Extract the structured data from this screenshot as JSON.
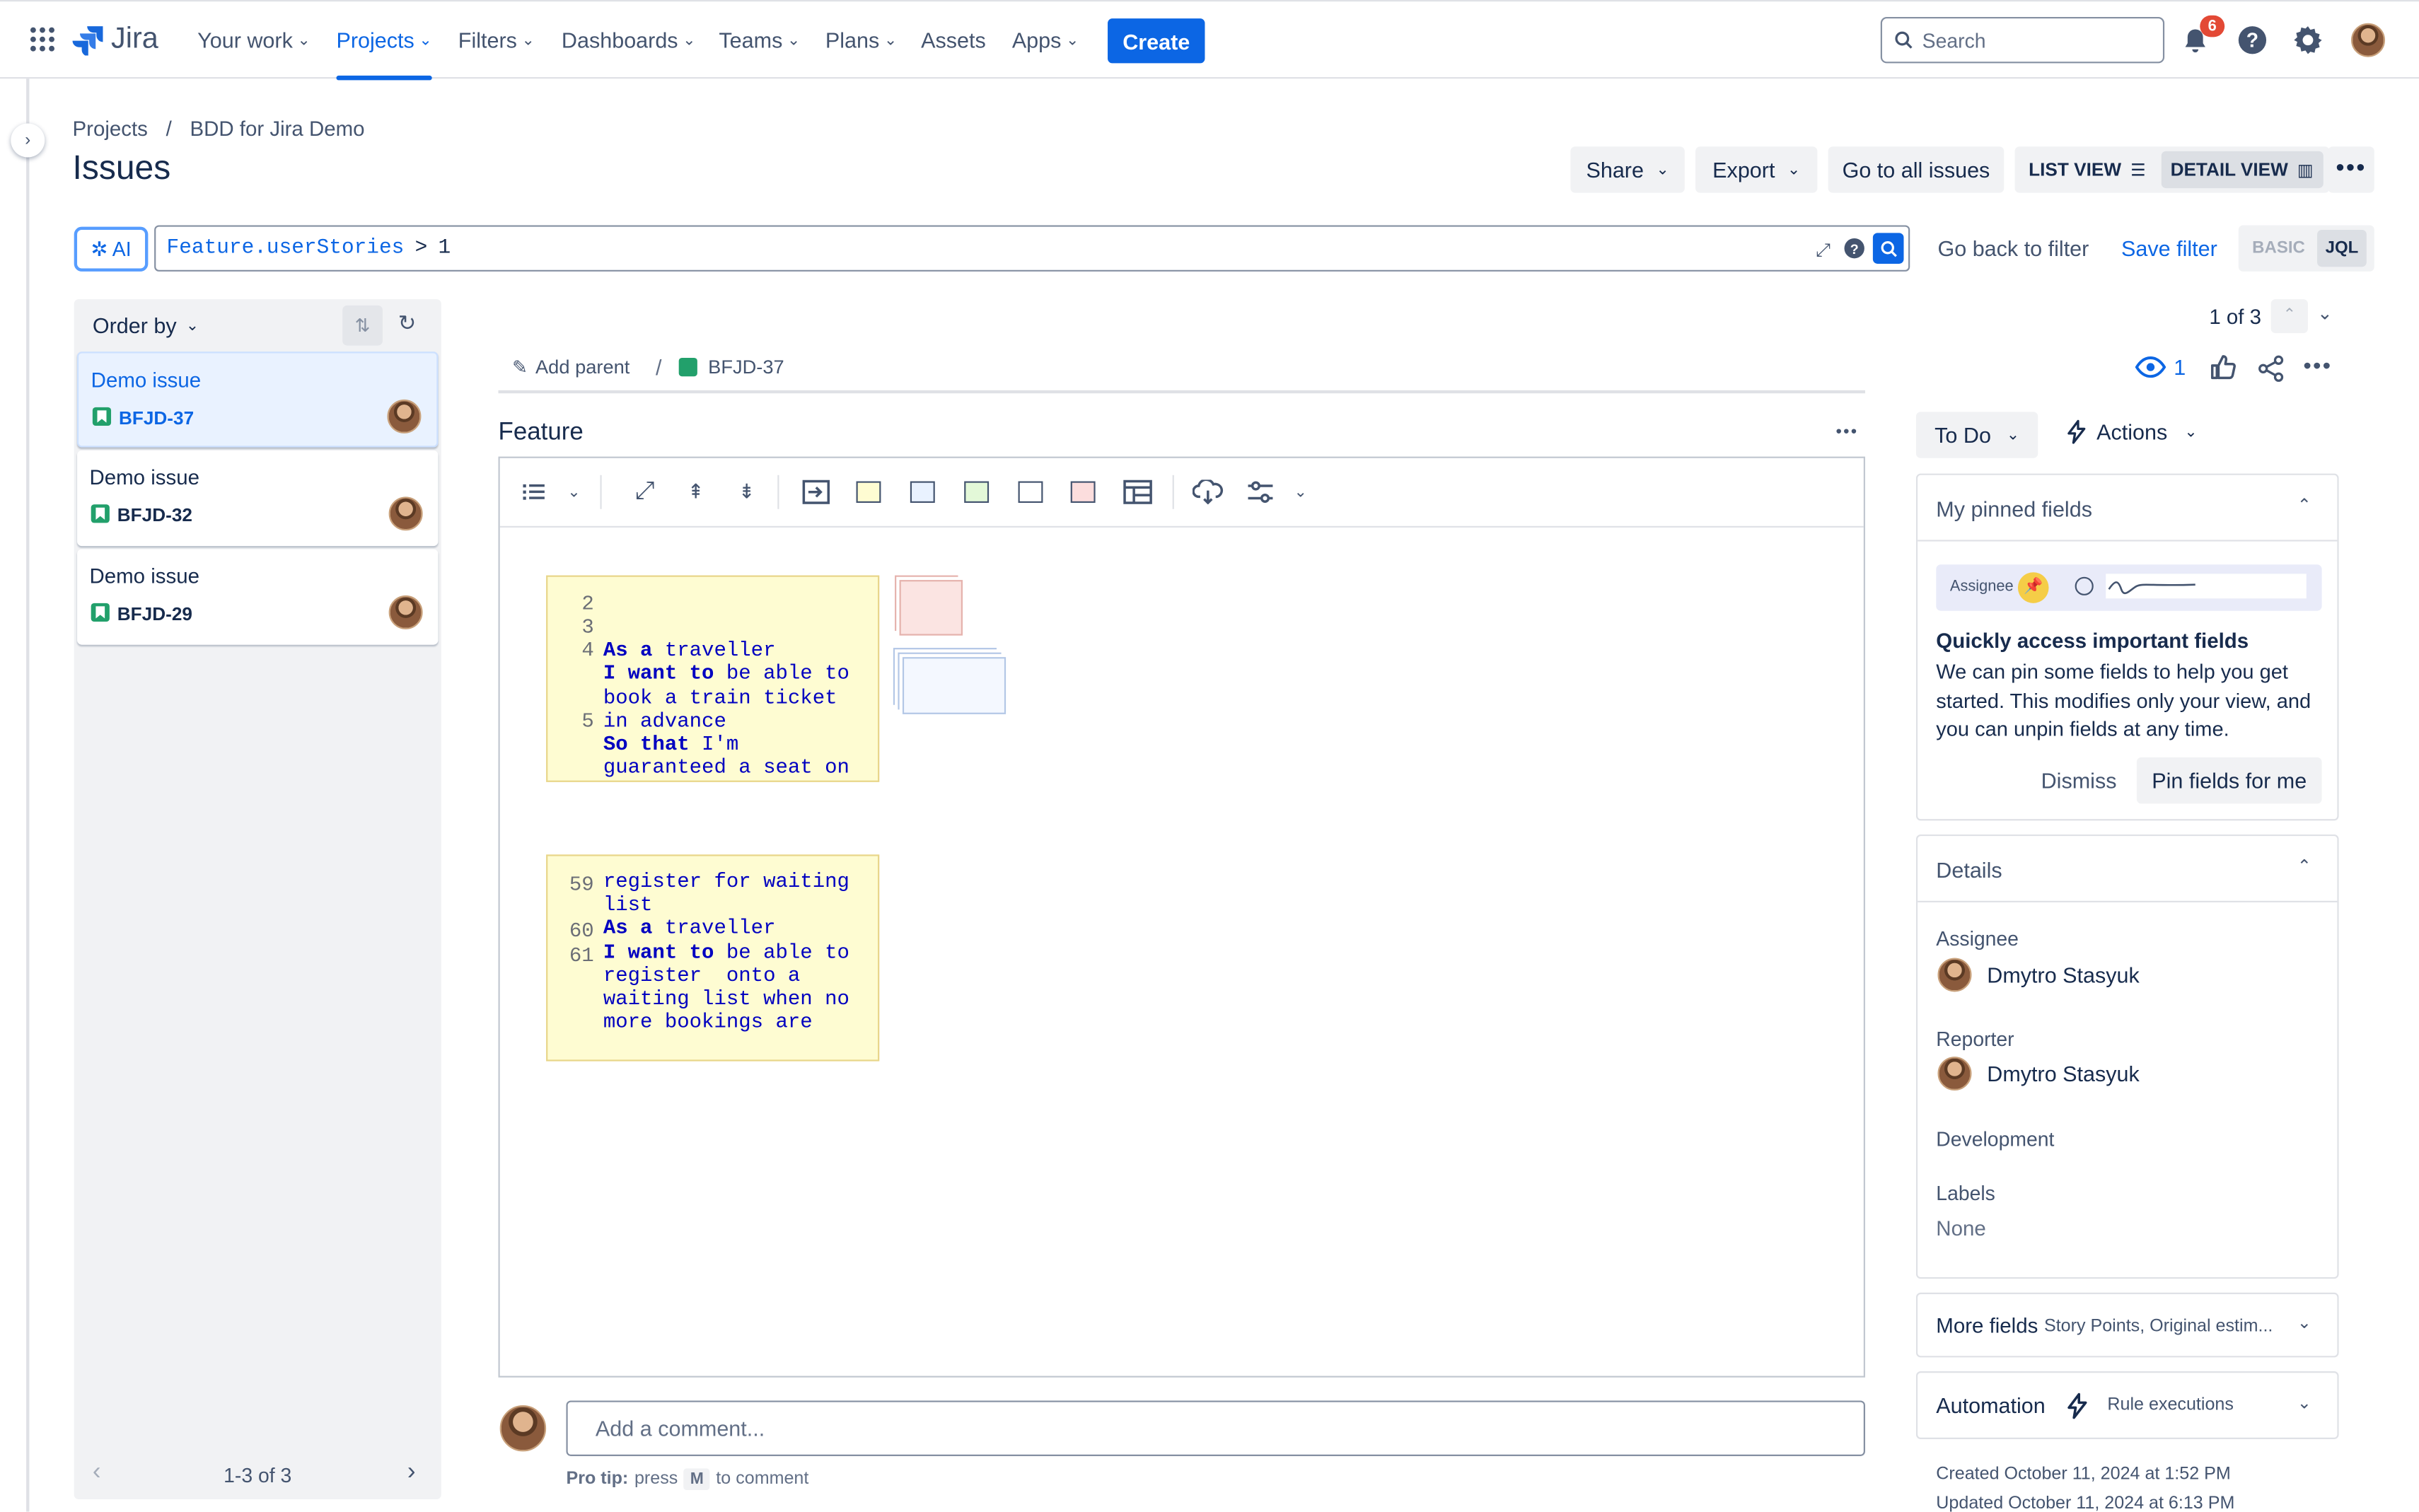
{
  "app": {
    "name": "Jira"
  },
  "nav": {
    "items": [
      {
        "label": "Your work"
      },
      {
        "label": "Projects"
      },
      {
        "label": "Filters"
      },
      {
        "label": "Dashboards"
      },
      {
        "label": "Teams"
      },
      {
        "label": "Plans"
      },
      {
        "label": "Assets"
      },
      {
        "label": "Apps"
      }
    ],
    "create": "Create",
    "search_placeholder": "Search",
    "notif_count": "6"
  },
  "breadcrumb": {
    "projects": "Projects",
    "sep": "/",
    "project": "BDD for Jira Demo"
  },
  "page": {
    "title": "Issues"
  },
  "toolbar": {
    "share": "Share",
    "export": "Export",
    "go_all": "Go to all issues",
    "list_view": "LIST VIEW",
    "detail_view": "DETAIL VIEW"
  },
  "filterbar": {
    "ai": "AI",
    "jql_field": "Feature.userStories",
    "jql_op": ">",
    "jql_value": "1",
    "go_back": "Go back to filter",
    "save": "Save filter",
    "basic": "BASIC",
    "jql": "JQL"
  },
  "list": {
    "order_by": "Order by",
    "pagination": "1-3 of 3",
    "issues": [
      {
        "title": "Demo issue",
        "key": "BFJD-37"
      },
      {
        "title": "Demo issue",
        "key": "BFJD-32"
      },
      {
        "title": "Demo issue",
        "key": "BFJD-29"
      }
    ]
  },
  "issue": {
    "counter": "1 of 3",
    "add_parent": "Add parent",
    "key": "BFJD-37",
    "watchers": "1",
    "field_title": "Feature"
  },
  "editor": {
    "note1": {
      "lines": [
        "2",
        "3",
        "4",
        "",
        "",
        "5",
        ""
      ],
      "text": [
        {
          "kw": "",
          "t": ""
        },
        {
          "kw": "As a",
          "t": " traveller"
        },
        {
          "kw": "I want to",
          "t": " be able to book a train ticket in advance"
        },
        {
          "kw": "So that",
          "t": " I'm guaranteed a seat on my travel"
        }
      ]
    },
    "note2": {
      "text": [
        {
          "kw": "",
          "t": "register for waiting list"
        },
        {
          "kw": "As a",
          "t": " traveller"
        },
        {
          "kw": "I want to",
          "t": " be able to register  onto a waiting list when no more bookings are"
        }
      ]
    }
  },
  "comment": {
    "placeholder": "Add a comment...",
    "pro_tip": "Pro tip:",
    "press": "press",
    "key": "M",
    "to_comment": "to comment"
  },
  "sidebar": {
    "status": "To Do",
    "actions": "Actions",
    "pinned": {
      "title": "My pinned fields",
      "assignee_chip": "Assignee",
      "heading": "Quickly access important fields",
      "body": "We can pin some fields to help you get started. This modifies only your view, and you can unpin fields at any time.",
      "dismiss": "Dismiss",
      "pin": "Pin fields for me"
    },
    "details": {
      "title": "Details",
      "assignee_label": "Assignee",
      "assignee": "Dmytro Stasyuk",
      "reporter_label": "Reporter",
      "reporter": "Dmytro Stasyuk",
      "development_label": "Development",
      "labels_label": "Labels",
      "labels": "None"
    },
    "more_fields": {
      "title": "More fields",
      "sub": "Story Points, Original estim..."
    },
    "automation": {
      "title": "Automation",
      "sub": "Rule executions"
    },
    "created": "Created October 11, 2024 at 1:52 PM",
    "updated": "Updated October 11, 2024 at 6:13 PM"
  },
  "colors": {
    "brand": "#0c66e4",
    "status_green": "#22a06b",
    "badge": "#e34935"
  }
}
